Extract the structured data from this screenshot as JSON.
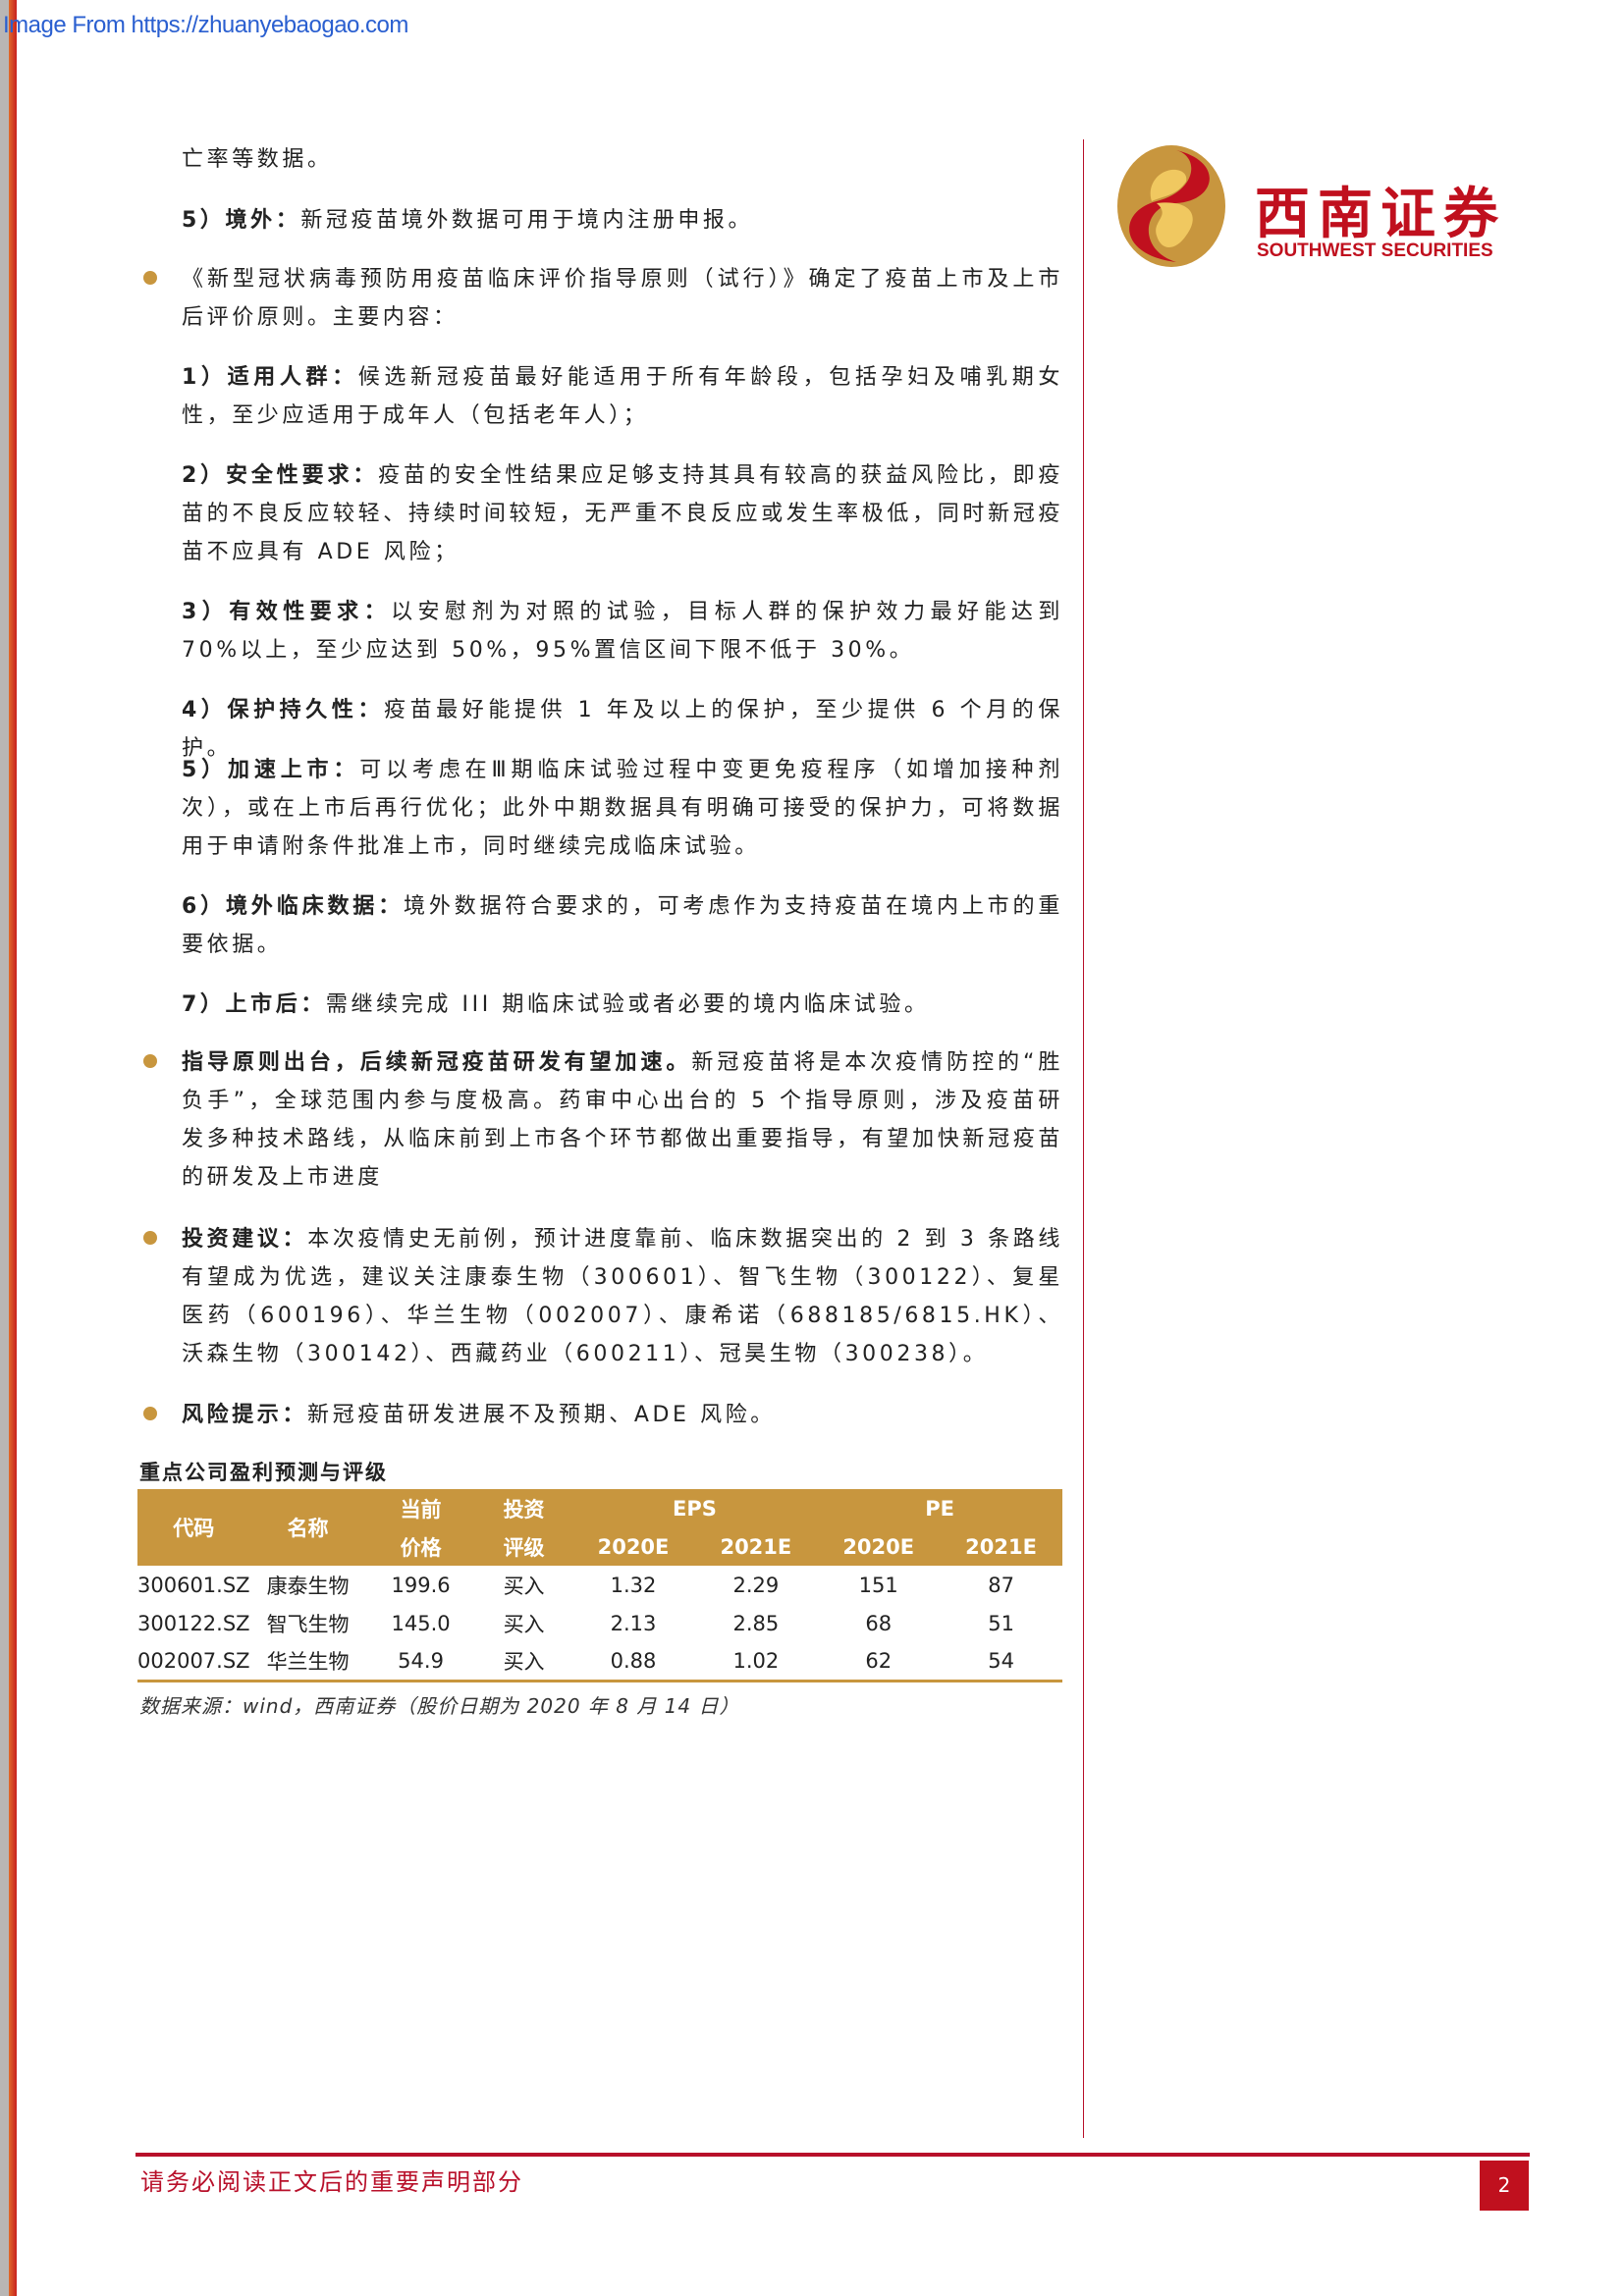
{
  "watermark": "Image From https://zhuanyebaogao.com",
  "logo": {
    "cn": "西南证券",
    "en": "SOUTHWEST SECURITIES"
  },
  "paras": [
    {
      "text": "亡率等数据。"
    },
    {
      "lead": "5）境外：",
      "text": "新冠疫苗境外数据可用于境内注册申报。"
    },
    {
      "text": "《新型冠状病毒预防用疫苗临床评价指导原则（试行）》确定了疫苗上市及上市后评价原则。主要内容："
    },
    {
      "lead": "1）适用人群：",
      "text": "候选新冠疫苗最好能适用于所有年龄段，包括孕妇及哺乳期女性，至少应适用于成年人（包括老年人）；"
    },
    {
      "lead": "2）安全性要求：",
      "text": "疫苗的安全性结果应足够支持其具有较高的获益风险比，即疫苗的不良反应较轻、持续时间较短，无严重不良反应或发生率极低，同时新冠疫苗不应具有 ADE 风险；"
    },
    {
      "lead": "3）有效性要求：",
      "text": "以安慰剂为对照的试验，目标人群的保护效力最好能达到 70%以上，至少应达到 50%，95%置信区间下限不低于 30%。"
    },
    {
      "lead": "4）保护持久性：",
      "text": "疫苗最好能提供 1 年及以上的保护，至少提供 6 个月的保护。"
    },
    {
      "lead": "5）加速上市：",
      "text": "可以考虑在Ⅲ期临床试验过程中变更免疫程序（如增加接种剂次），或在上市后再行优化；此外中期数据具有明确可接受的保护力，可将数据用于申请附条件批准上市，同时继续完成临床试验。"
    },
    {
      "lead": "6）境外临床数据：",
      "text": "境外数据符合要求的，可考虑作为支持疫苗在境内上市的重要依据。"
    },
    {
      "lead": "7）上市后：",
      "text": "需继续完成 III 期临床试验或者必要的境内临床试验。"
    },
    {
      "lead": "指导原则出台，后续新冠疫苗研发有望加速。",
      "text": "新冠疫苗将是本次疫情防控的“胜负手”，全球范围内参与度极高。药审中心出台的 5 个指导原则，涉及疫苗研发多种技术路线，从临床前到上市各个环节都做出重要指导，有望加快新冠疫苗的研发及上市进度"
    },
    {
      "lead": "投资建议：",
      "text": "本次疫情史无前例，预计进度靠前、临床数据突出的 2 到 3 条路线有望成为优选，建议关注康泰生物（300601）、智飞生物（300122）、复星医药（600196）、华兰生物（002007）、康希诺（688185/6815.HK）、沃森生物（300142）、西藏药业（600211）、冠昊生物（300238）。"
    },
    {
      "lead": "风险提示：",
      "text": "新冠疫苗研发进展不及预期、ADE 风险。"
    }
  ],
  "table": {
    "title": "重点公司盈利预测与评级",
    "headers": {
      "code": "代码",
      "name": "名称",
      "price1": "当前",
      "price2": "价格",
      "rating1": "投资",
      "rating2": "评级",
      "eps": "EPS",
      "pe": "PE",
      "y1": "2020E",
      "y2": "2021E"
    },
    "rows": [
      [
        "300601.SZ",
        "康泰生物",
        "199.6",
        "买入",
        "1.32",
        "2.29",
        "151",
        "87"
      ],
      [
        "300122.SZ",
        "智飞生物",
        "145.0",
        "买入",
        "2.13",
        "2.85",
        "68",
        "51"
      ],
      [
        "002007.SZ",
        "华兰生物",
        "54.9",
        "买入",
        "0.88",
        "1.02",
        "62",
        "54"
      ]
    ],
    "source": "数据来源：wind，西南证券（股价日期为 2020 年 8 月 14 日）"
  },
  "footer": {
    "notice": "请务必阅读正文后的重要声明部分",
    "page": "2"
  },
  "colors": {
    "accent": "#c8963e",
    "brand_red": "#c0101e"
  }
}
